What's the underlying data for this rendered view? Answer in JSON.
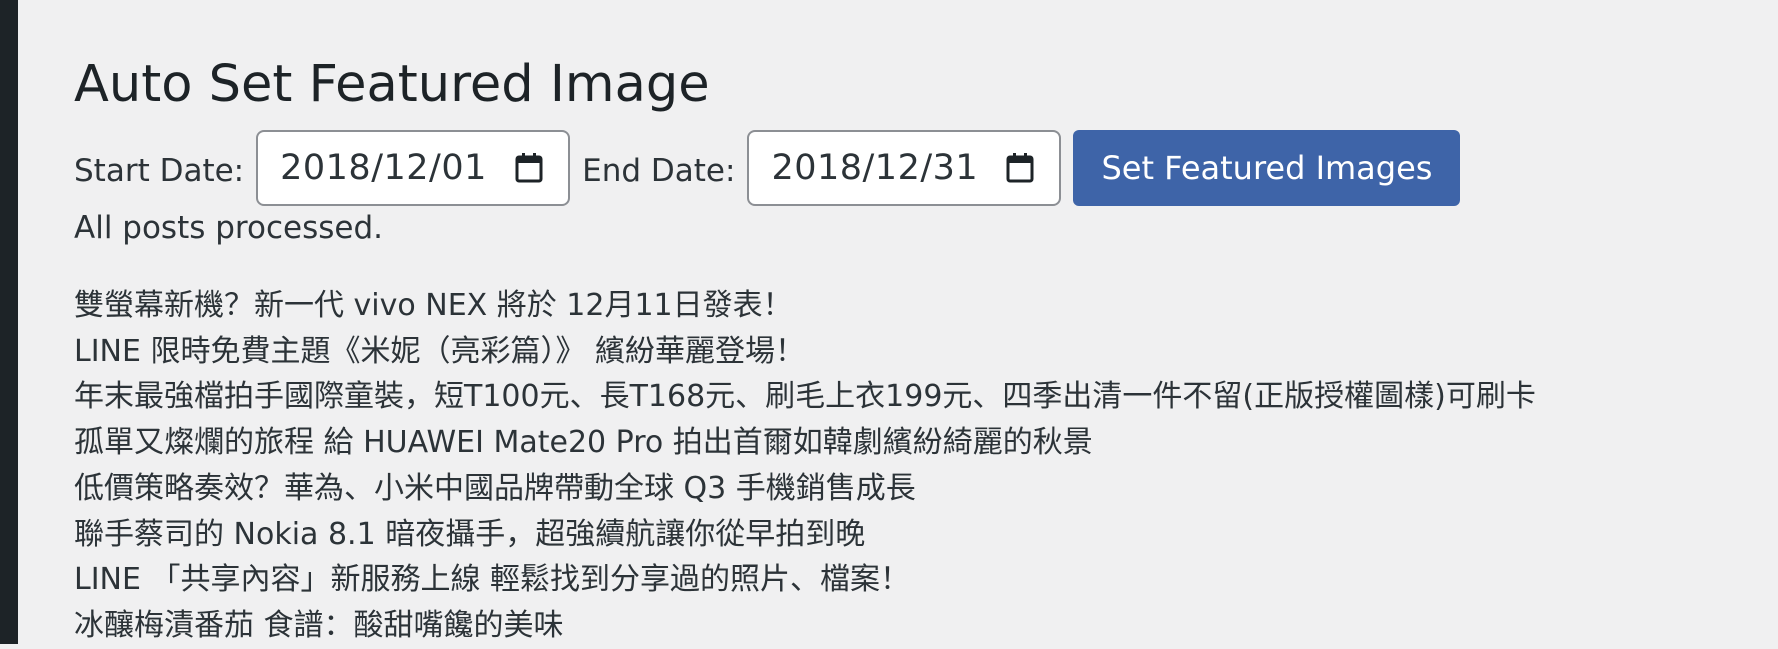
{
  "page": {
    "title": "Auto Set Featured Image"
  },
  "form": {
    "start_label": "Start Date:",
    "start_value": "2018/12/01",
    "end_label": "End Date:",
    "end_value": "2018/12/31",
    "submit_label": "Set Featured Images"
  },
  "status": {
    "message": "All posts processed."
  },
  "posts": [
    "雙螢幕新機？新一代 vivo NEX 將於 12月11日發表！",
    "LINE 限時免費主題《米妮（亮彩篇）》 繽紛華麗登場！",
    "年末最強檔拍手國際童裝，短T100元、長T168元、刷毛上衣199元、四季出清一件不留(正版授權圖樣)可刷卡",
    "孤單又燦爛的旅程 給 HUAWEI Mate20 Pro 拍出首爾如韓劇繽紛綺麗的秋景",
    "低價策略奏效？華為、小米中國品牌帶動全球 Q3 手機銷售成長",
    "聯手蔡司的 Nokia 8.1 暗夜攝手，超強續航讓你從早拍到晚",
    "LINE 「共享內容」新服務上線 輕鬆找到分享過的照片、檔案！",
    "冰釀梅漬番茄 食譜：酸甜嘴饞的美味"
  ],
  "icons": {
    "date_picker": "calendar-icon"
  },
  "colors": {
    "background": "#f0f0f1",
    "sidebar": "#1d2327",
    "primary_button": "#3e64a8",
    "text": "#2c3338"
  }
}
